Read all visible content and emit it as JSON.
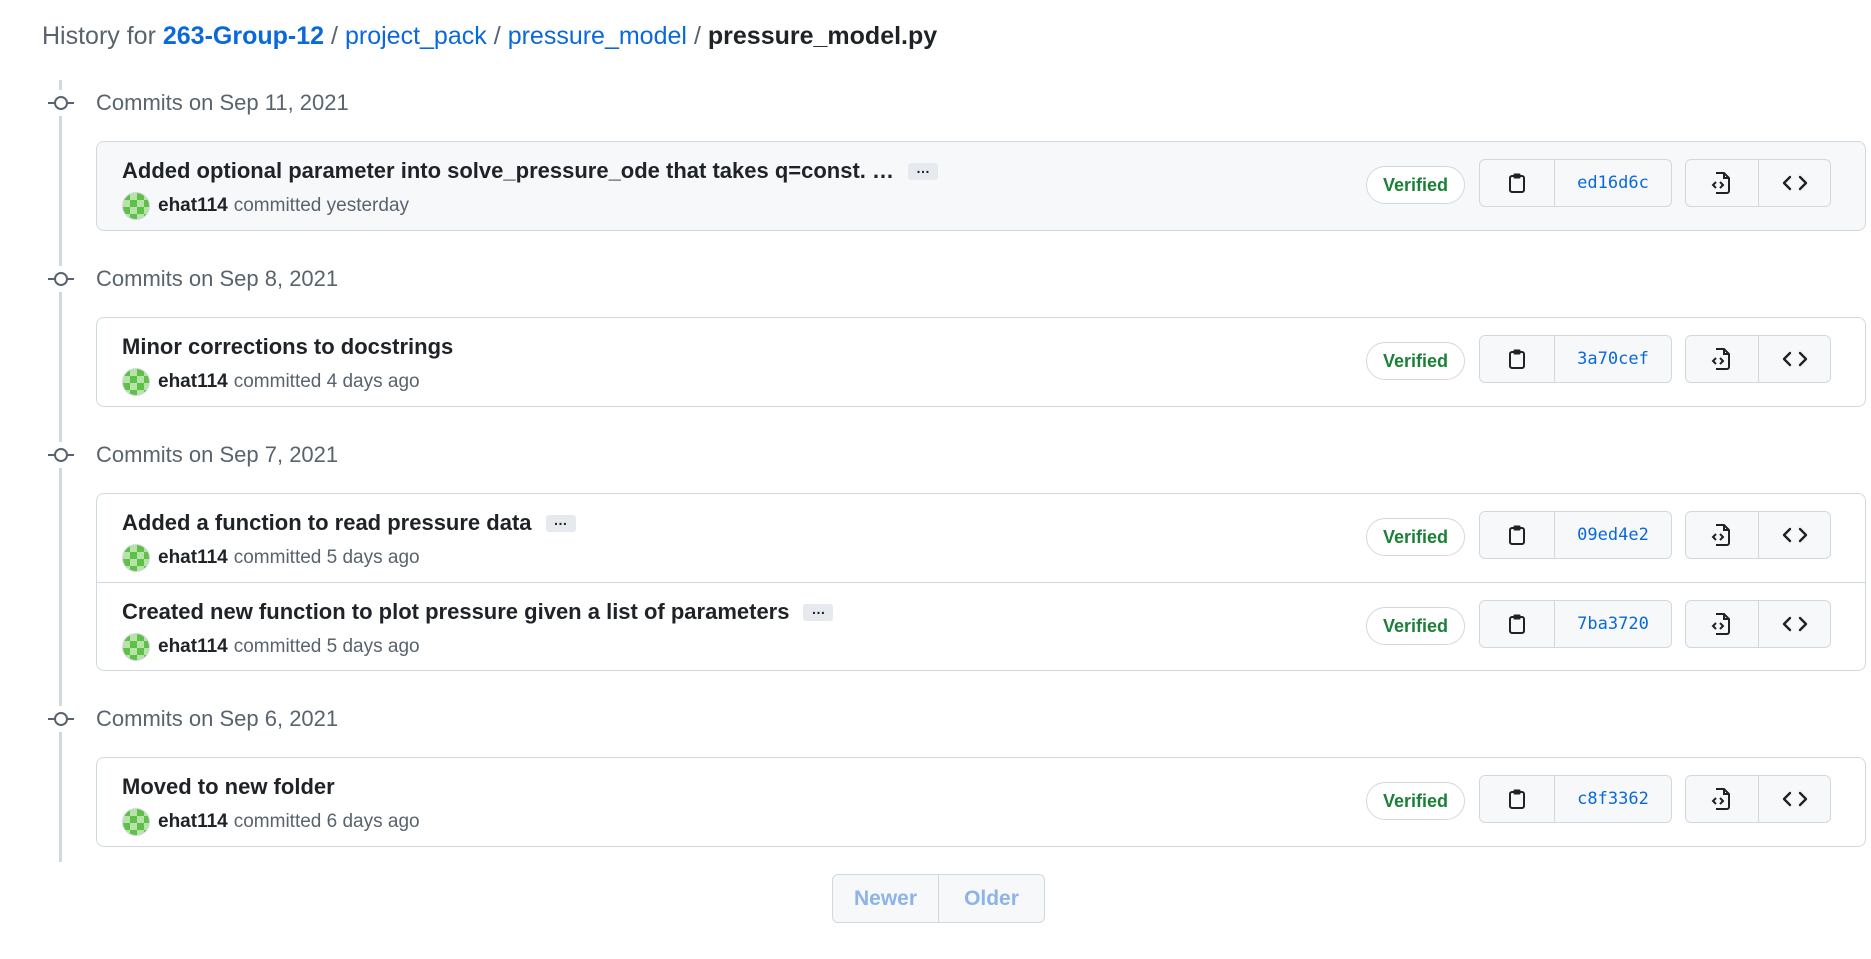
{
  "breadcrumb": {
    "prefix": "History for",
    "repo": "263-Group-12",
    "path1": "project_pack",
    "path2": "pressure_model",
    "file": "pressure_model.py",
    "separator": "/"
  },
  "groups": [
    {
      "label": "Commits on Sep 11, 2021",
      "commits": [
        {
          "message": "Added optional parameter into solve_pressure_ode that takes q=const. …",
          "has_more": true,
          "author": "ehat114",
          "when": "committed yesterday",
          "badge": "Verified",
          "sha": "ed16d6c"
        }
      ]
    },
    {
      "label": "Commits on Sep 8, 2021",
      "commits": [
        {
          "message": "Minor corrections to docstrings",
          "has_more": false,
          "author": "ehat114",
          "when": "committed 4 days ago",
          "badge": "Verified",
          "sha": "3a70cef"
        }
      ]
    },
    {
      "label": "Commits on Sep 7, 2021",
      "commits": [
        {
          "message": "Added a function to read pressure data",
          "has_more": true,
          "author": "ehat114",
          "when": "committed 5 days ago",
          "badge": "Verified",
          "sha": "09ed4e2"
        },
        {
          "message": "Created new function to plot pressure given a list of parameters",
          "has_more": true,
          "author": "ehat114",
          "when": "committed 5 days ago",
          "badge": "Verified",
          "sha": "7ba3720"
        }
      ]
    },
    {
      "label": "Commits on Sep 6, 2021",
      "commits": [
        {
          "message": "Moved to new folder",
          "has_more": false,
          "author": "ehat114",
          "when": "committed 6 days ago",
          "badge": "Verified",
          "sha": "c8f3362"
        }
      ]
    }
  ],
  "ellipsis_label": "…",
  "pagination": {
    "newer": "Newer",
    "older": "Older"
  },
  "icons": {
    "copy": "copy-icon",
    "browse_file": "file-code-icon",
    "browse_repo": "code-icon",
    "timeline_node": "git-commit-icon"
  },
  "colors": {
    "link": "#0969da",
    "verified": "#1a7f37",
    "muted": "#59636e"
  }
}
